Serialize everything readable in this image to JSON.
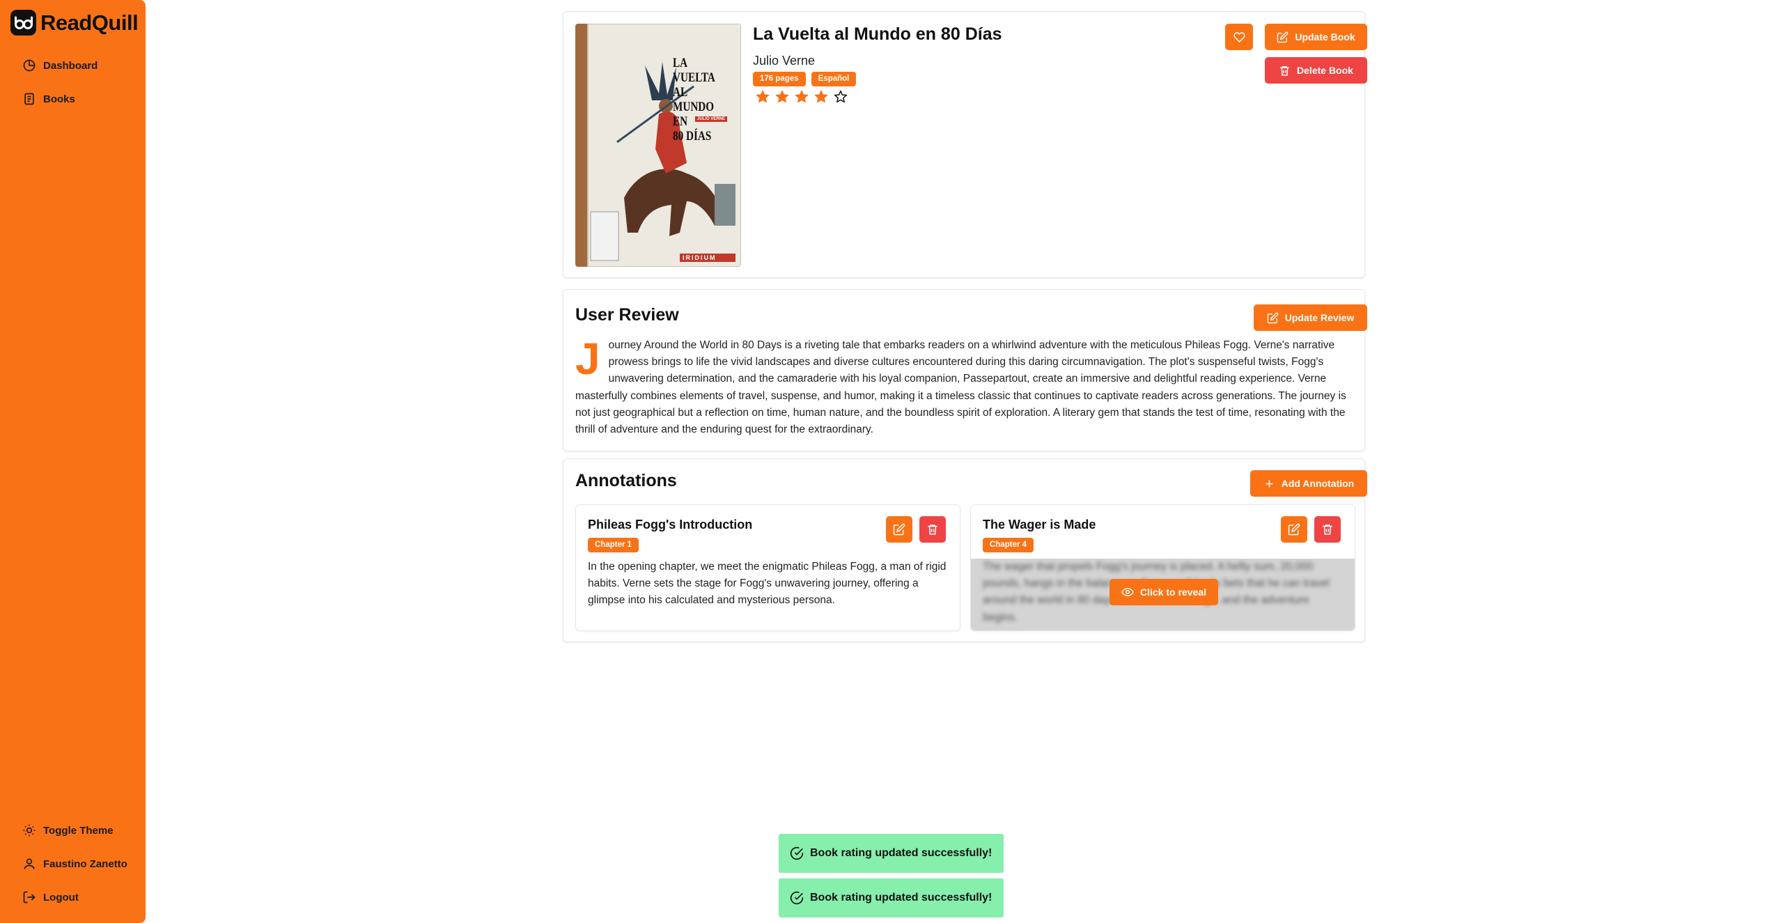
{
  "app": {
    "name": "ReadQuill"
  },
  "sidebar": {
    "items": [
      {
        "label": "Dashboard",
        "icon": "dashboard-icon"
      },
      {
        "label": "Books",
        "icon": "book-icon"
      }
    ],
    "footer": [
      {
        "label": "Toggle Theme",
        "icon": "sun-icon"
      },
      {
        "label": "Faustino Zanetto",
        "icon": "user-icon"
      },
      {
        "label": "Logout",
        "icon": "logout-icon"
      }
    ]
  },
  "book": {
    "title": "La Vuelta al Mundo en 80 Días",
    "author": "Julio Verne",
    "pages_badge": "176 pages",
    "language_badge": "Español",
    "rating": 4,
    "rating_max": 5,
    "cover": {
      "line1": "LA",
      "line2": "VUELTA",
      "line3": "AL MUNDO",
      "line4": "EN",
      "line5": "80 DÍAS",
      "author_tag": "JULIO VERNE",
      "publisher": "IRIDIUM"
    }
  },
  "actions": {
    "favorite_icon": "heart-icon",
    "update_book": "Update Book",
    "delete_book": "Delete Book"
  },
  "review": {
    "heading": "User Review",
    "update_label": "Update Review",
    "dropcap": "J",
    "text": "ourney Around the World in 80 Days is a riveting tale that embarks readers on a whirlwind adventure with the meticulous Phileas Fogg. Verne's narrative prowess brings to life the vivid landscapes and diverse cultures encountered during this daring circumnavigation. The plot's suspenseful twists, Fogg's unwavering determination, and the camaraderie with his loyal companion, Passepartout, create an immersive and delightful reading experience. Verne masterfully combines elements of travel, suspense, and humor, making it a timeless classic that continues to captivate readers across generations. The journey is not just geographical but a reflection on time, human nature, and the boundless spirit of exploration. A literary gem that stands the test of time, resonating with the thrill of adventure and the enduring quest for the extraordinary."
  },
  "annotations": {
    "heading": "Annotations",
    "add_label": "Add Annotation",
    "items": [
      {
        "title": "Phileas Fogg's Introduction",
        "chapter": "Chapter 1",
        "text": "In the opening chapter, we meet the enigmatic Phileas Fogg, a man of rigid habits. Verne sets the stage for Fogg's unwavering journey, offering a glimpse into his calculated and mysterious persona."
      },
      {
        "title": "The Wager is Made",
        "chapter": "Chapter 4",
        "text": "The wager that propels Fogg's journey is placed. A hefty sum, 20,000 pounds, hangs in the balance as Fogg confidently bets that he can travel around the world in 80 days. The stakes are high, and the adventure begins.",
        "reveal_label": "Click to reveal"
      }
    ]
  },
  "toasts": [
    {
      "message": "Book rating updated successfully!"
    },
    {
      "message": "Book rating updated successfully!"
    }
  ],
  "colors": {
    "accent": "#f97316",
    "danger": "#ef4444",
    "success": "#86efac"
  }
}
